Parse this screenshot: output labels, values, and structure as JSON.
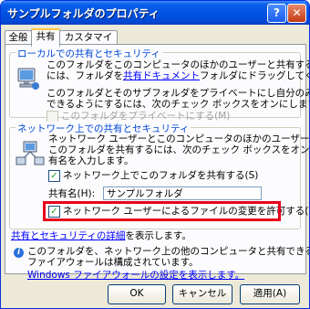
{
  "window": {
    "title": "サンプルフォルダのプロパティ",
    "help": "?",
    "close": "✕"
  },
  "tabs": [
    {
      "label": "全般"
    },
    {
      "label": "共有"
    },
    {
      "label": "カスタマイズ"
    }
  ],
  "local": {
    "legend": "ローカルでの共有とセキュリティ",
    "desc1_pre": "このフォルダをこのコンピュータのほかのユーザーと共有する",
    "desc2_pre": "には、フォルダを",
    "desc2_link": "共有ドキュメント",
    "desc2_post": "フォルダにドラッグしてください。",
    "desc3": "このフォルダとそのサブフォルダをプライベートにし自分のみがアクセス",
    "desc4": "できるようにするには、次のチェック ボックスをオンにします。",
    "private_label": "このフォルダをプライベートにする(M)"
  },
  "network": {
    "legend": "ネットワーク上での共有とセキュリティ",
    "desc1": "ネットワーク ユーザーとこのコンピュータのほかのユーザーの両方と",
    "desc2": "このフォルダを共有するには、次のチェック ボックスをオンにしてから共",
    "desc3": "有名を入力します。",
    "share_label": "ネットワーク上でこのフォルダを共有する(S)",
    "share_checked": "✓",
    "share_name_label": "共有名(H):",
    "share_name_value": "サンプルフォルダ",
    "allow_change_label": "ネットワーク ユーザーによるファイルの変更を許可する(W)",
    "allow_change_checked": "✓",
    "security_link": "共有とセキュリティの詳細",
    "security_link_post": "を表示します。"
  },
  "firewall": {
    "info": "i",
    "text1": "このフォルダを、ネットワーク上の他のコンピュータと共有できるよう、Windows",
    "text2": "ファイアウォールは構成されています。",
    "link": "Windows ファイアウォールの設定を表示します。"
  },
  "buttons": {
    "ok": "OK",
    "cancel": "キャンセル",
    "apply": "適用(A)"
  }
}
